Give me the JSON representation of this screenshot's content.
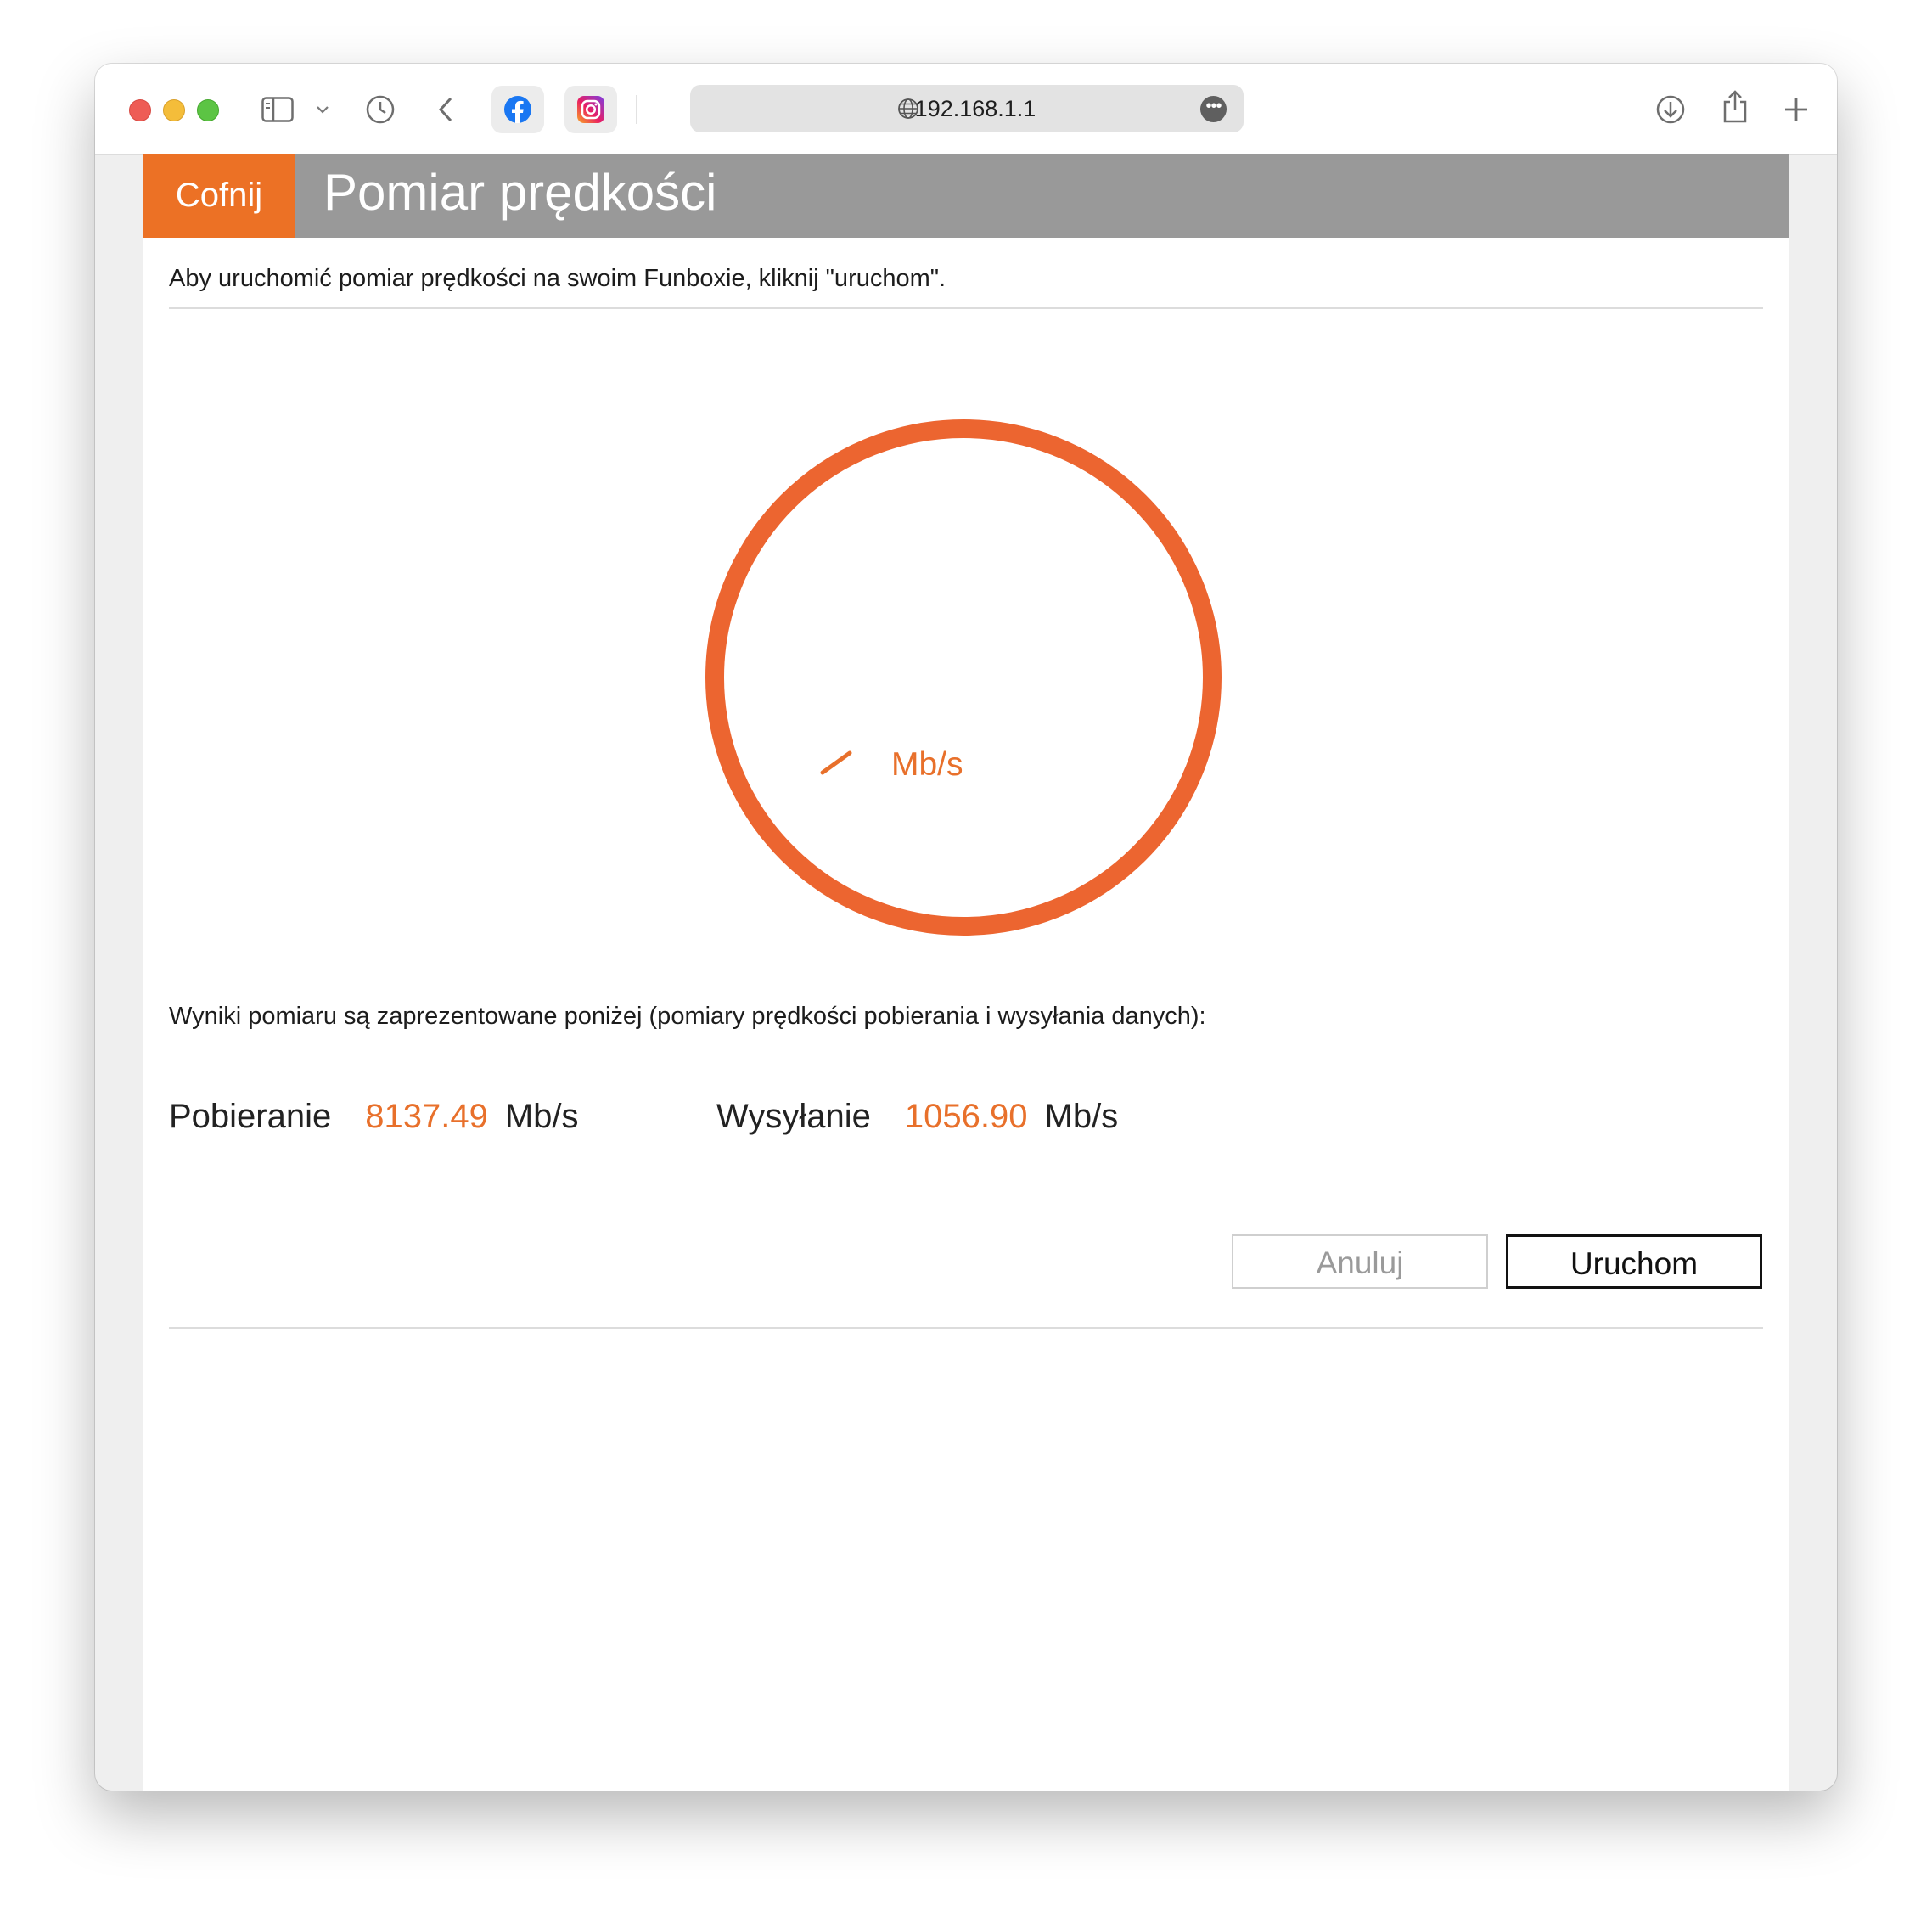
{
  "browser": {
    "url": "192.168.1.1",
    "favorites": [
      "facebook",
      "instagram"
    ],
    "toolbar_icons": [
      "sidebar-icon",
      "chevron-down-icon",
      "history-icon",
      "back-icon",
      "download-icon",
      "share-icon",
      "new-tab-icon"
    ]
  },
  "header": {
    "back_label": "Cofnij",
    "title": "Pomiar prędkości"
  },
  "intro_text": "Aby uruchomić pomiar prędkości na swoim Funboxie, kliknij \"uruchom\".",
  "gauge": {
    "value": "",
    "unit": "Mb/s",
    "color": "#ec6530"
  },
  "results": {
    "description": "Wyniki pomiaru są zaprezentowane poniżej (pomiary prędkości pobierania i wysyłania danych):",
    "download": {
      "label": "Pobieranie",
      "value": "8137.49",
      "unit": "Mb/s"
    },
    "upload": {
      "label": "Wysyłanie",
      "value": "1056.90",
      "unit": "Mb/s"
    }
  },
  "buttons": {
    "cancel": "Anuluj",
    "run": "Uruchom"
  },
  "colors": {
    "accent": "#ec7125",
    "header_bg": "#999999"
  }
}
